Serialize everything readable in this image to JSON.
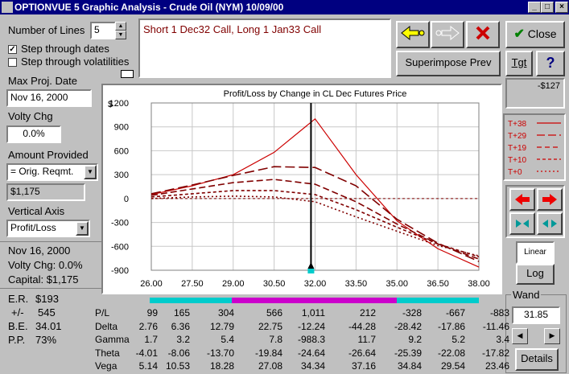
{
  "window": {
    "title": "OPTIONVUE 5 Graphic Analysis - Crude Oil (NYM)  10/09/00"
  },
  "controls": {
    "number_of_lines_label": "Number of Lines",
    "number_of_lines_value": "5",
    "step_dates_label": "Step through dates",
    "step_dates_checked": "✓",
    "step_vol_label": "Step through volatilities",
    "max_proj_date_label": "Max Proj. Date",
    "max_proj_date_value": "Nov 16, 2000",
    "volty_chg_label": "Volty Chg",
    "volty_chg_value": "0.0%",
    "amount_provided_label": "Amount Provided",
    "amount_provided_value": "= Orig. Reqmt.",
    "amount_value": "$1,175",
    "vertical_axis_label": "Vertical Axis",
    "vertical_axis_value": "Profit/Loss"
  },
  "position_text": "Short 1 Dec32 Call, Long 1 Jan33 Call",
  "summary": {
    "date": "Nov 16, 2000",
    "volty": "Volty Chg: 0.0%",
    "capital": "Capital: $1,175",
    "er_label": "E.R.",
    "er_value": "$193",
    "pm_label": "+/-",
    "pm_value": "545",
    "be_label": "B.E.",
    "be_value": "34.01",
    "pp_label": "P.P.",
    "pp_value": "73%"
  },
  "buttons": {
    "close": "Close",
    "superimpose": "Superimpose Prev",
    "tgt": "Tgt",
    "help": "?",
    "linear": "Linear",
    "log": "Log",
    "details": "Details"
  },
  "right_panel": {
    "value": "-$127",
    "wand_label": "Wand",
    "wand_value": "31.85"
  },
  "legend": [
    {
      "label": "T+38",
      "dash": ""
    },
    {
      "label": "T+29",
      "dash": "10,4"
    },
    {
      "label": "T+19",
      "dash": "6,4"
    },
    {
      "label": "T+10",
      "dash": "4,3"
    },
    {
      "label": "T+0",
      "dash": "2,3"
    }
  ],
  "chart_data": {
    "type": "line",
    "title": "Profit/Loss by Change in CL Dec Futures Price",
    "ylabel": "$",
    "xlim": [
      26,
      38
    ],
    "ylim": [
      -900,
      1200
    ],
    "xticks": [
      "26.00",
      "27.50",
      "29.00",
      "30.50",
      "32.00",
      "33.50",
      "35.00",
      "36.50",
      "38.00"
    ],
    "yticks": [
      "1200",
      "900",
      "600",
      "300",
      "0",
      "-300",
      "-600",
      "-900"
    ],
    "x": [
      26,
      27.5,
      29,
      30.5,
      32,
      33.5,
      35,
      36.5,
      38
    ],
    "series": [
      {
        "name": "T+38",
        "values": [
          50,
          160,
          300,
          580,
          1000,
          300,
          -280,
          -630,
          -860
        ]
      },
      {
        "name": "T+29",
        "values": [
          60,
          170,
          290,
          400,
          390,
          160,
          -260,
          -560,
          -790
        ]
      },
      {
        "name": "T+19",
        "values": [
          40,
          120,
          200,
          240,
          180,
          -40,
          -320,
          -570,
          -760
        ]
      },
      {
        "name": "T+10",
        "values": [
          20,
          60,
          100,
          100,
          50,
          -140,
          -360,
          -570,
          -730
        ]
      },
      {
        "name": "T+0",
        "values": [
          0,
          20,
          30,
          20,
          -40,
          -230,
          -410,
          -590,
          -720
        ]
      }
    ],
    "zero_line": true,
    "cursor_x": 31.85,
    "range_bar": {
      "from": 29,
      "to": 35
    }
  },
  "table": {
    "columns": 9,
    "rows": [
      {
        "label": "P/L",
        "values": [
          "99",
          "165",
          "304",
          "566",
          "1,011",
          "212",
          "-328",
          "-667",
          "-883"
        ]
      },
      {
        "label": "Delta",
        "values": [
          "2.76",
          "6.36",
          "12.79",
          "22.75",
          "-12.24",
          "-44.28",
          "-28.42",
          "-17.86",
          "-11.46"
        ]
      },
      {
        "label": "Gamma",
        "values": [
          "1.7",
          "3.2",
          "5.4",
          "7.8",
          "-988.3",
          "11.7",
          "9.2",
          "5.2",
          "3.4"
        ]
      },
      {
        "label": "Theta",
        "values": [
          "-4.01",
          "-8.06",
          "-13.70",
          "-19.84",
          "-24.64",
          "-26.64",
          "-25.39",
          "-22.08",
          "-17.82"
        ]
      },
      {
        "label": "Vega",
        "values": [
          "5.14",
          "10.53",
          "18.28",
          "27.08",
          "34.34",
          "37.16",
          "34.84",
          "29.54",
          "23.46"
        ]
      }
    ]
  },
  "colors": {
    "titlebar": "#000080",
    "curve": "#cc0000",
    "curve_dark": "#800000",
    "range": "#cc00cc",
    "cyan": "#00cccc"
  }
}
